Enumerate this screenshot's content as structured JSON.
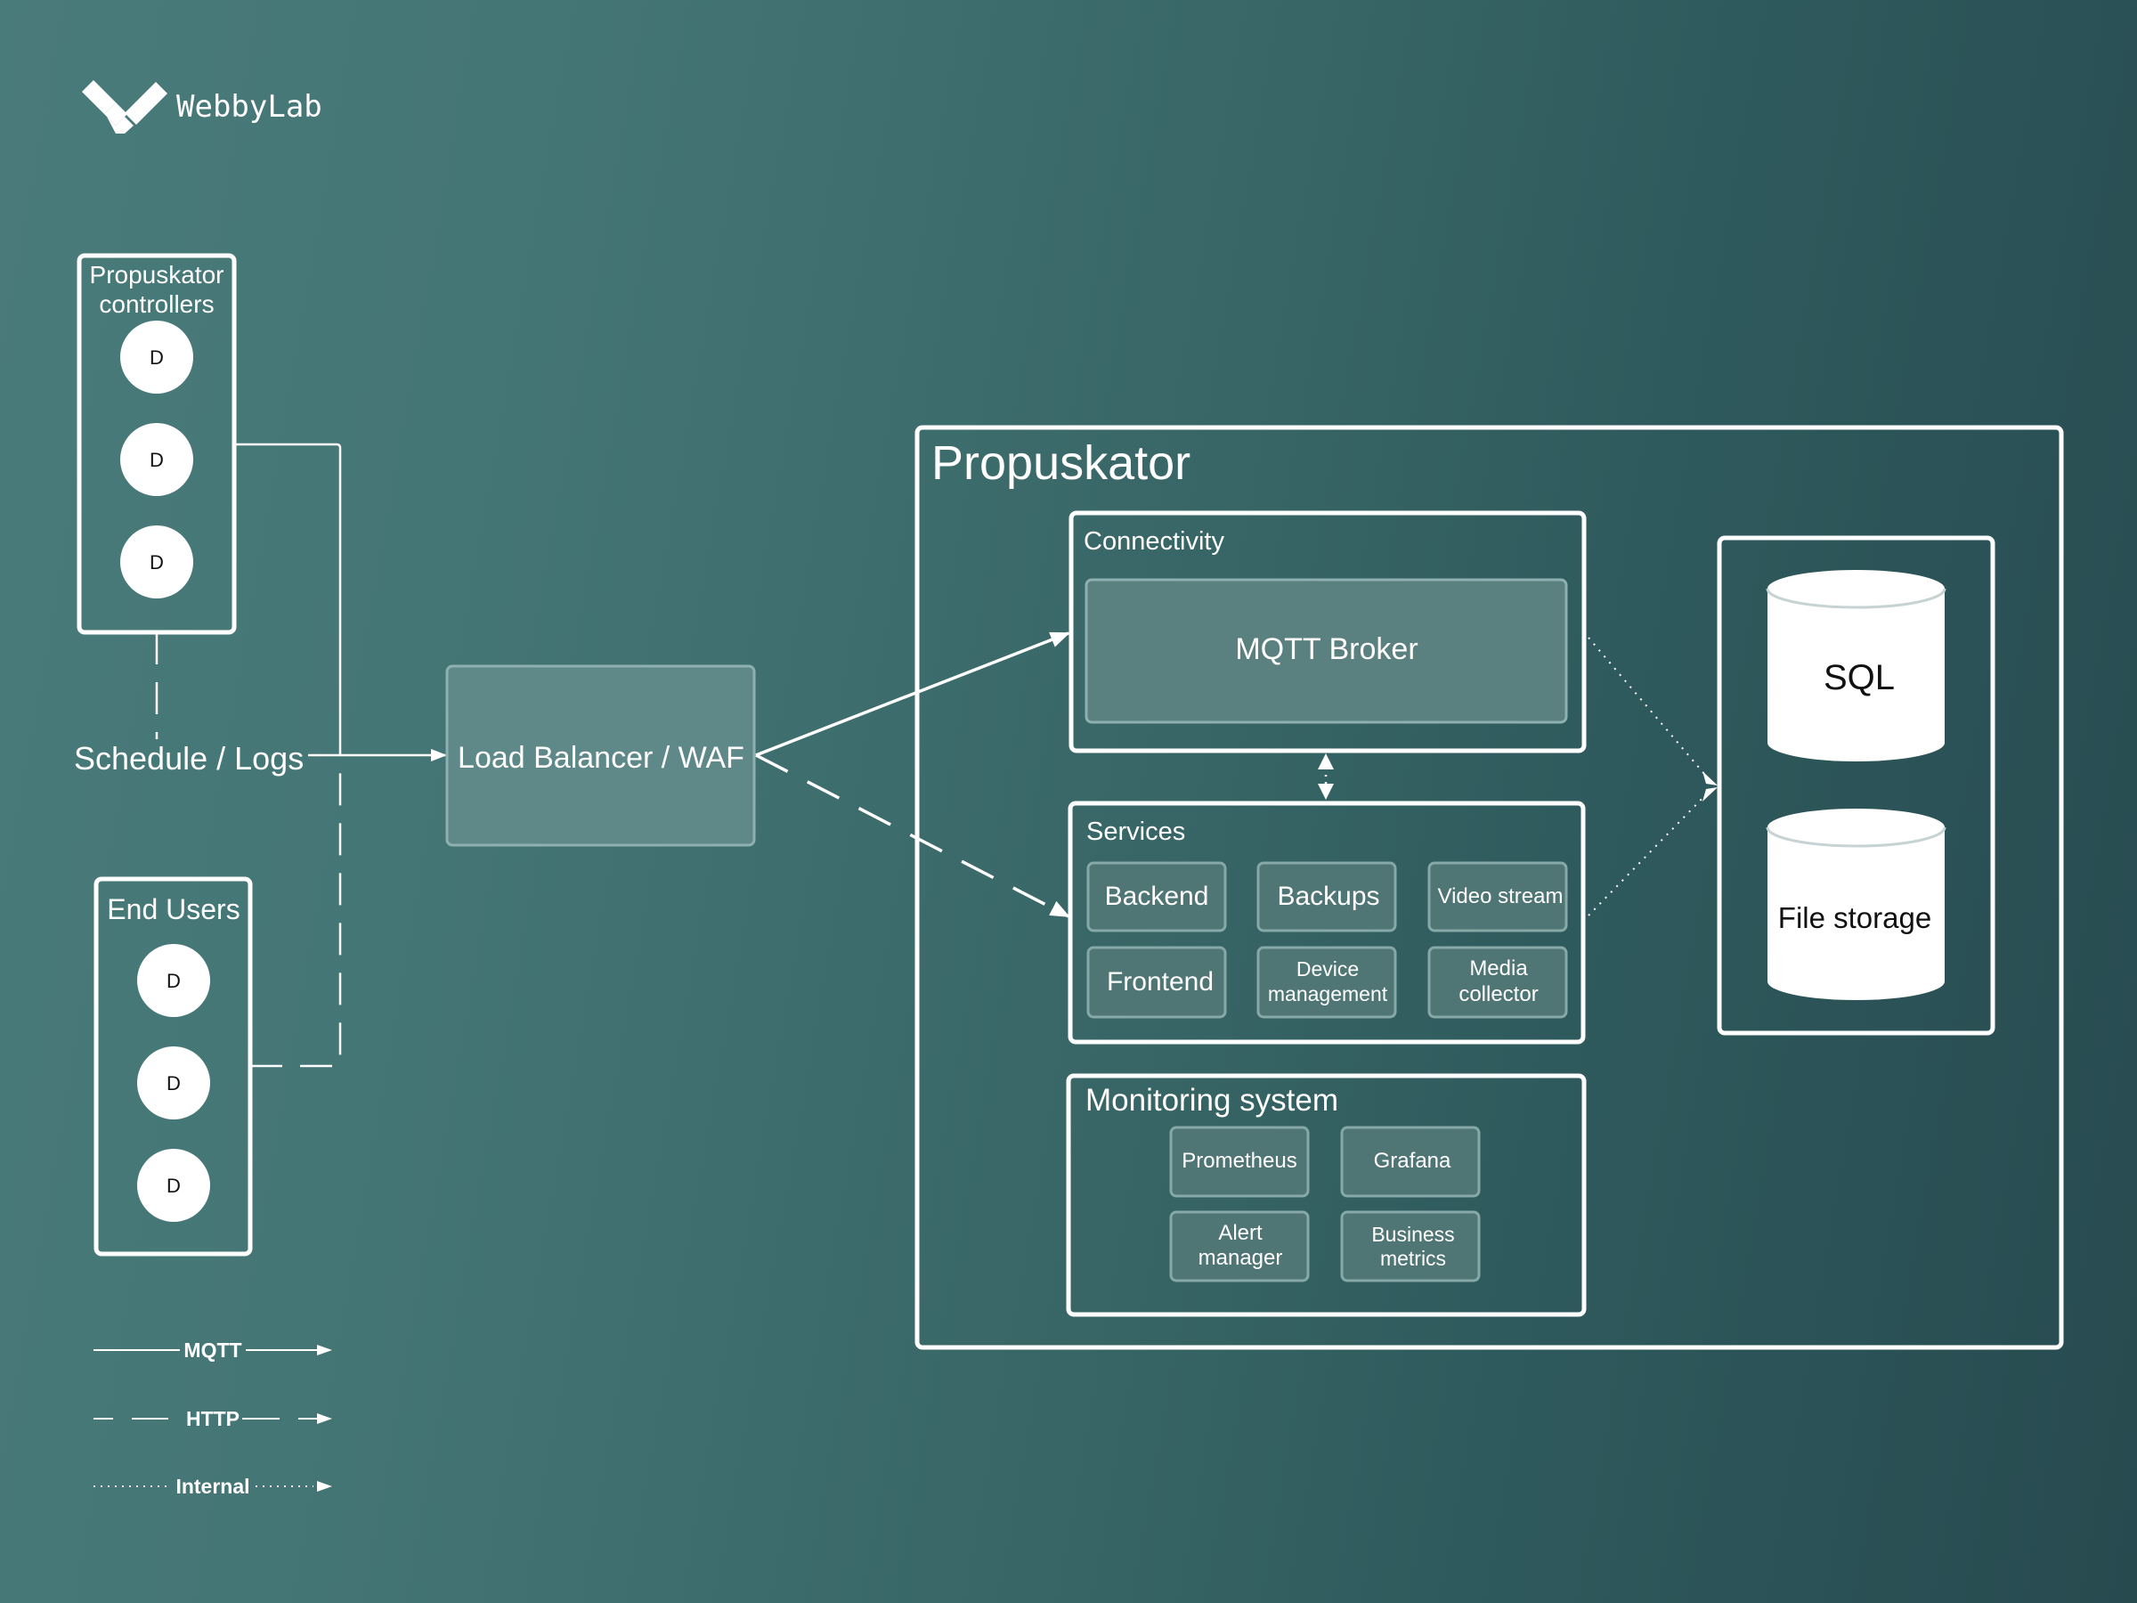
{
  "logo": {
    "brand": "WebbyLab"
  },
  "colors": {
    "background_light": "#4a7b7b",
    "background_dark": "#274a4f",
    "stroke": "#ffffff",
    "card_fill": "#4f7675"
  },
  "controllers": {
    "title_line1": "Propuskator",
    "title_line2": "controllers",
    "devices": [
      "D",
      "D",
      "D"
    ]
  },
  "end_users": {
    "title": "End Users",
    "devices": [
      "D",
      "D",
      "D"
    ]
  },
  "schedule_logs": {
    "label": "Schedule / Logs"
  },
  "load_balancer": {
    "label": "Load Balancer / WAF"
  },
  "propuskator": {
    "title": "Propuskator",
    "connectivity": {
      "title": "Connectivity",
      "broker": "MQTT Broker"
    },
    "services": {
      "title": "Services",
      "items": [
        {
          "line1": "Backend",
          "line2": ""
        },
        {
          "line1": "Backups",
          "line2": ""
        },
        {
          "line1": "Video stream",
          "line2": ""
        },
        {
          "line1": "Frontend",
          "line2": ""
        },
        {
          "line1": "Device",
          "line2": "management"
        },
        {
          "line1": "Media",
          "line2": "collector"
        }
      ]
    },
    "monitoring": {
      "title": "Monitoring system",
      "items": [
        {
          "line1": "Prometheus",
          "line2": ""
        },
        {
          "line1": "Grafana",
          "line2": ""
        },
        {
          "line1": "Alert",
          "line2": "manager"
        },
        {
          "line1": "Business",
          "line2": "metrics"
        }
      ]
    },
    "storage": {
      "sql": "SQL",
      "files": "File storage"
    }
  },
  "legend": {
    "items": [
      {
        "label": "MQTT",
        "style": "solid"
      },
      {
        "label": "HTTP",
        "style": "dashed"
      },
      {
        "label": "Internal",
        "style": "dotted"
      }
    ]
  }
}
